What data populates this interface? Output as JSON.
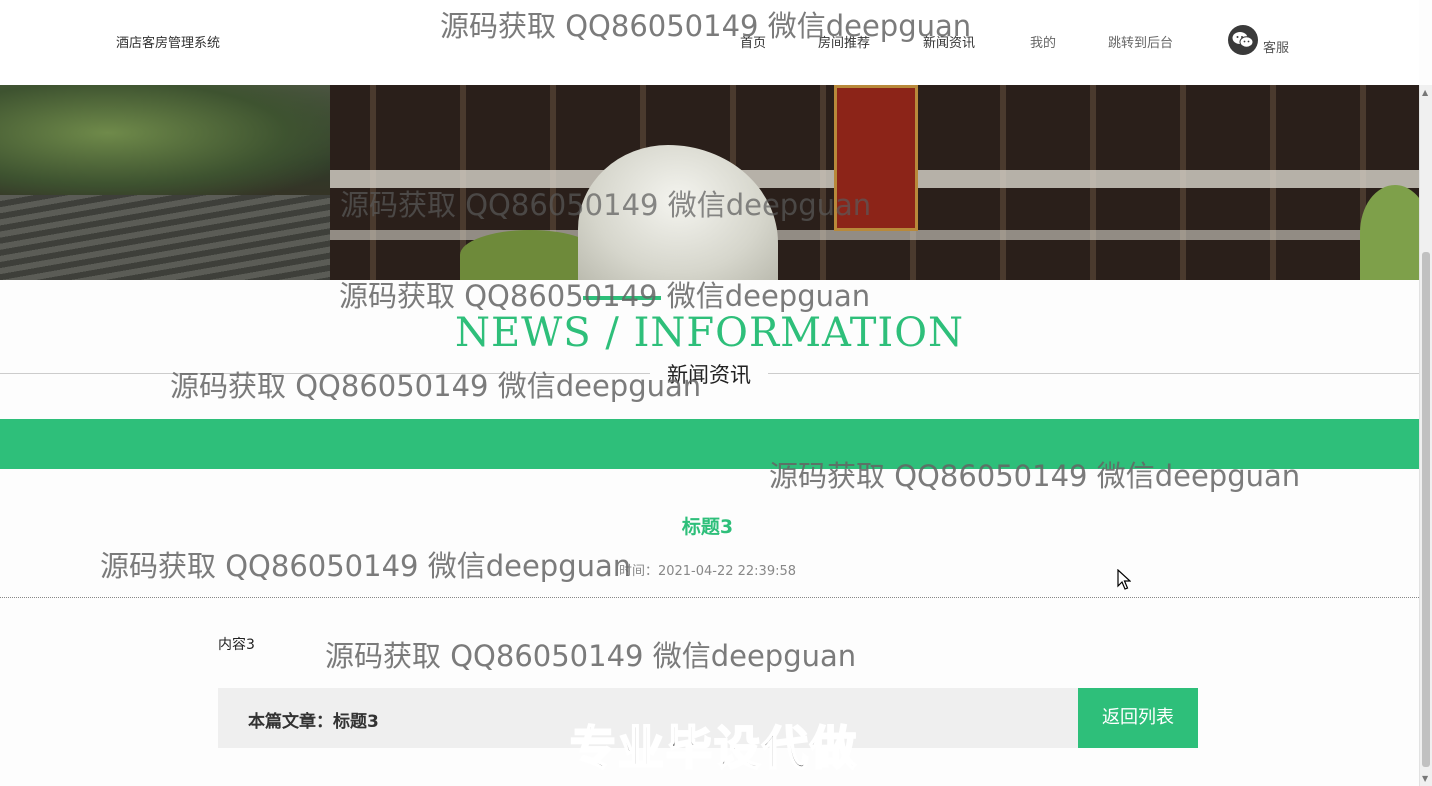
{
  "header": {
    "logo": "酒店客房管理系统",
    "nav": [
      {
        "label": "首页"
      },
      {
        "label": "房间推荐"
      },
      {
        "label": "新闻资讯"
      },
      {
        "label": "我的"
      },
      {
        "label": "跳转到后台"
      }
    ],
    "customer_service": {
      "label": "客服",
      "icon": "wechat-icon"
    }
  },
  "section": {
    "title_en": "NEWS / INFORMATION",
    "title_cn": "新闻资讯"
  },
  "article": {
    "title": "标题3",
    "time": "时间：2021-04-22 22:39:58",
    "content": "内容3",
    "current_label": "本篇文章：标题3",
    "back_label": "返回列表"
  },
  "watermarks": {
    "repeat": "源码获取 QQ86050149 微信deepguan",
    "banner": "源码获取 QQ86050149 微信deepguan",
    "big": "专业毕设代做"
  },
  "colors": {
    "accent": "#2ebf7a",
    "footbar_bg": "#efefef",
    "text": "#333333"
  }
}
